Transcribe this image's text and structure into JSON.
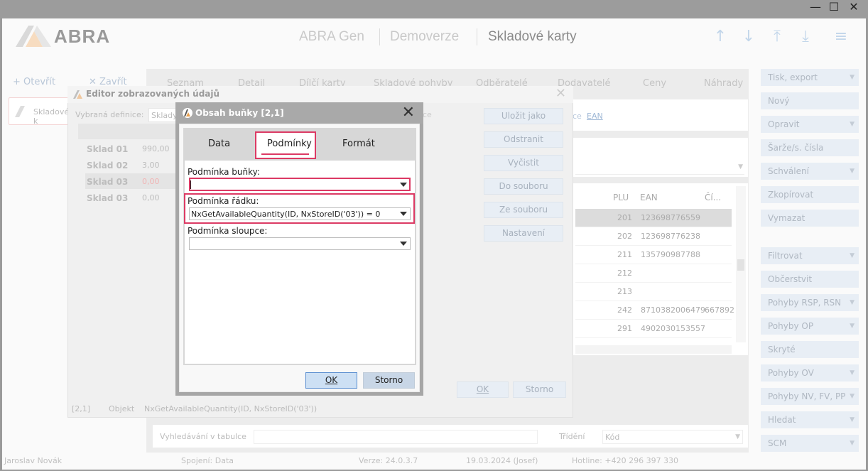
{
  "window": {
    "minimize": "—",
    "maximize": "☐",
    "close": "✕"
  },
  "header": {
    "brand": "ABRA",
    "breadcrumbs": [
      "ABRA Gen",
      "Demoverze",
      "Skladové karty"
    ],
    "nav_icons": [
      "arrow-up-icon",
      "arrow-down-icon",
      "arrow-top-icon",
      "arrow-bottom-icon",
      "hamburger-menu-icon"
    ]
  },
  "left": {
    "open_label": "Otevřít",
    "close_label": "Zavřít",
    "card_label": "Skladové k"
  },
  "tabs": [
    "Seznam",
    "Detail",
    "Dílčí karty",
    "Skladové pohyby",
    "Odběratelé",
    "Dodavatelé",
    "Ceny",
    "Náhrady"
  ],
  "top_links": [
    "ce",
    "EAN"
  ],
  "grid": {
    "headers": [
      "PLU",
      "EAN",
      "Čí..."
    ],
    "rows": [
      {
        "plu": "201",
        "ean": "123698776559",
        "extra": ""
      },
      {
        "plu": "202",
        "ean": "123698776238",
        "extra": ""
      },
      {
        "plu": "211",
        "ean": "135790987788",
        "extra": ""
      },
      {
        "plu": "212",
        "ean": "",
        "extra": ""
      },
      {
        "plu": "213",
        "ean": "",
        "extra": ""
      },
      {
        "plu": "242",
        "ean": "8710382006479",
        "extra": "667892"
      },
      {
        "plu": "291",
        "ean": "4902030153557",
        "extra": ""
      }
    ]
  },
  "search": {
    "label": "Vyhledávání v tabulce",
    "sort_label": "Třídění",
    "sort_value": "Kód"
  },
  "sidebar": [
    {
      "label": "Tisk, export",
      "arrow": true
    },
    {
      "label": "Nový",
      "arrow": false
    },
    {
      "label": "Opravit",
      "arrow": true
    },
    {
      "label": "Šarže/s. čísla",
      "arrow": false
    },
    {
      "label": "Schválení",
      "arrow": true
    },
    {
      "label": "Zkopírovat",
      "arrow": false
    },
    {
      "label": "Vymazat",
      "arrow": false
    },
    {
      "label": "Filtrovat",
      "arrow": true
    },
    {
      "label": "Občerstvit",
      "arrow": false
    },
    {
      "label": "Pohyby RSP, RSN",
      "arrow": true
    },
    {
      "label": "Pohyby OP",
      "arrow": true
    },
    {
      "label": "Skryté",
      "arrow": false
    },
    {
      "label": "Pohyby OV",
      "arrow": true
    },
    {
      "label": "Pohyby NV, FV, PP",
      "arrow": true
    },
    {
      "label": "Hledat",
      "arrow": true
    },
    {
      "label": "SCM",
      "arrow": true
    }
  ],
  "status": {
    "user": "Jaroslav Novák",
    "connection": "Spojení: Data",
    "version": "Verze: 24.0.3.7",
    "date": "19.03.2024 (Josef)",
    "hotline": "Hotline: +420 296 397 330"
  },
  "editor": {
    "title": "Editor zobrazovaných údajů",
    "definition_label": "Vybraná definice:",
    "definition_value": "Sklady",
    "rows": [
      {
        "name": "Sklad 01",
        "value": "990,00"
      },
      {
        "name": "Sklad 02",
        "value": "3,00"
      },
      {
        "name": "Sklad 03",
        "value": "0,00"
      },
      {
        "name": "Sklad 03",
        "value": "0,00"
      }
    ],
    "buttons": [
      "Uložit jako",
      "Odstranit",
      "Vyčistit",
      "Do souboru",
      "Ze souboru",
      "Nastavení"
    ],
    "ok": "OK",
    "cancel": "Storno",
    "footer_cell": "[2,1]",
    "footer_object": "Objekt",
    "footer_expr": "NxGetAvailableQuantity(ID, NxStoreID('03'))"
  },
  "dialog": {
    "title": "Obsah buňky [2,1]",
    "close": "✕",
    "tabs": [
      "Data",
      "Podmínky",
      "Formát"
    ],
    "cell_condition_label": "Podmínka buňky:",
    "cell_condition_value": "",
    "row_condition_label": "Podmínka řádku:",
    "row_condition_value": "NxGetAvailableQuantity(ID, NxStoreID('03')) = 0",
    "col_condition_label": "Podmínka sloupce:",
    "col_condition_value": "",
    "ok": "OK",
    "cancel": "Storno"
  },
  "colors": {
    "highlight": "#dc3a64",
    "accent": "#c2d6ea"
  }
}
